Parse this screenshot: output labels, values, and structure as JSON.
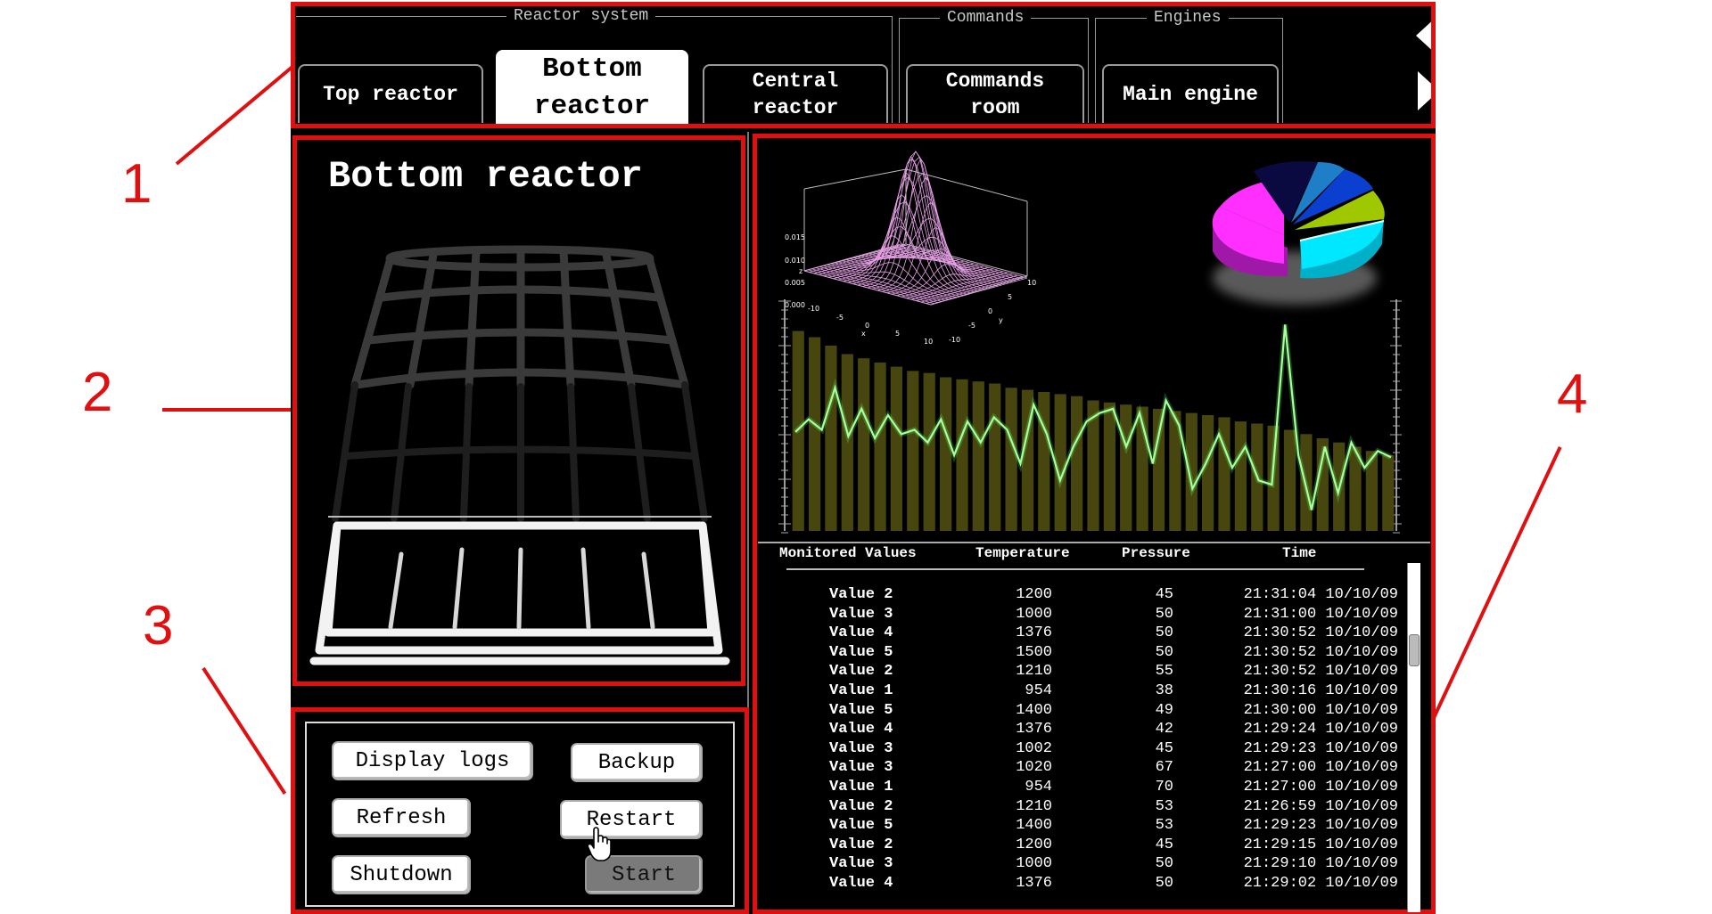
{
  "callouts": [
    "1",
    "2",
    "3",
    "4"
  ],
  "tab_groups": [
    {
      "label": "Reactor system"
    },
    {
      "label": "Commands"
    },
    {
      "label": "Engines"
    }
  ],
  "tabs": [
    {
      "label": "Top reactor",
      "active": false
    },
    {
      "label": "Bottom reactor",
      "active": true
    },
    {
      "label": "Central reactor",
      "active": false
    },
    {
      "label": "Commands room",
      "active": false
    },
    {
      "label": "Main engine",
      "active": false
    }
  ],
  "reactor_panel": {
    "title": "Bottom reactor"
  },
  "surface_plot": {
    "z_ticks": [
      "0.015",
      "0.010",
      "0.005",
      "0.000"
    ],
    "z_label": "z",
    "x_ticks": [
      "-10",
      "-5",
      "0",
      "5",
      "10"
    ],
    "x_label": "x",
    "y_ticks": [
      "10",
      "5",
      "0",
      "-5",
      "-10"
    ],
    "y_label": "y"
  },
  "pie_colors": [
    "#ff30ff",
    "#00e8ff",
    "#a0c800",
    "#0a3fd0",
    "#1e7fc8",
    "#0a0a40"
  ],
  "chart_data": {
    "type": "bar",
    "bar_values": [
      95,
      92,
      88,
      84,
      82,
      80,
      78,
      76,
      75,
      73,
      72,
      71,
      70,
      68,
      67,
      66,
      65,
      64,
      62,
      61,
      60,
      59,
      58,
      57,
      56,
      55,
      54,
      52,
      51,
      50,
      48,
      46,
      44,
      42,
      40,
      38,
      36
    ],
    "line_values": [
      47,
      53,
      48,
      68,
      45,
      58,
      44,
      55,
      46,
      48,
      42,
      53,
      36,
      52,
      42,
      54,
      48,
      32,
      60,
      46,
      24,
      40,
      52,
      56,
      58,
      40,
      56,
      32,
      62,
      50,
      20,
      32,
      46,
      30,
      40,
      24,
      22,
      98,
      36,
      10,
      40,
      18,
      42,
      30,
      38,
      35
    ],
    "ylim": [
      0,
      110
    ],
    "grid": false
  },
  "table": {
    "headers": [
      "Monitored Values",
      "Temperature",
      "Pressure",
      "Time"
    ],
    "rows": [
      [
        "Value 2",
        "1200",
        "45",
        "21:31:04 10/10/09"
      ],
      [
        "Value 3",
        "1000",
        "50",
        "21:31:00 10/10/09"
      ],
      [
        "Value 4",
        "1376",
        "50",
        "21:30:52 10/10/09"
      ],
      [
        "Value 5",
        "1500",
        "50",
        "21:30:52 10/10/09"
      ],
      [
        "Value 2",
        "1210",
        "55",
        "21:30:52 10/10/09"
      ],
      [
        "Value 1",
        "954",
        "38",
        "21:30:16 10/10/09"
      ],
      [
        "Value 5",
        "1400",
        "49",
        "21:30:00 10/10/09"
      ],
      [
        "Value 4",
        "1376",
        "42",
        "21:29:24 10/10/09"
      ],
      [
        "Value 3",
        "1002",
        "45",
        "21:29:23 10/10/09"
      ],
      [
        "Value 3",
        "1020",
        "67",
        "21:27:00 10/10/09"
      ],
      [
        "Value 1",
        "954",
        "70",
        "21:27:00 10/10/09"
      ],
      [
        "Value 2",
        "1210",
        "53",
        "21:26:59 10/10/09"
      ],
      [
        "Value 5",
        "1400",
        "53",
        "21:29:23 10/10/09"
      ],
      [
        "Value 2",
        "1200",
        "45",
        "21:29:15 10/10/09"
      ],
      [
        "Value 3",
        "1000",
        "50",
        "21:29:10 10/10/09"
      ],
      [
        "Value 4",
        "1376",
        "50",
        "21:29:02 10/10/09"
      ]
    ]
  },
  "buttons": {
    "display_logs": "Display logs",
    "backup": "Backup",
    "refresh": "Refresh",
    "restart": "Restart",
    "shutdown": "Shutdown",
    "start": "Start"
  },
  "icons": {
    "cursor": "hand-pointer-icon",
    "prev": "triangle-left-icon",
    "next": "triangle-right-icon"
  }
}
